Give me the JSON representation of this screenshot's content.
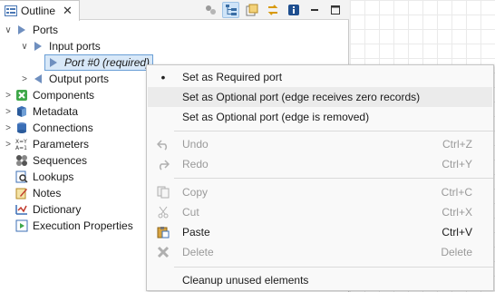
{
  "tab": {
    "title": "Outline",
    "close": "✕"
  },
  "toolbar": {
    "icons": [
      "tools-icon",
      "tree-layout-icon",
      "properties-icon",
      "sync-icon",
      "info-icon",
      "minimize-icon",
      "maximize-icon"
    ]
  },
  "tree": {
    "ports": "Ports",
    "input_ports": "Input ports",
    "port0": "Port #0 (required)",
    "output_ports": "Output ports",
    "components": "Components",
    "metadata": "Metadata",
    "connections": "Connections",
    "parameters": "Parameters",
    "sequences": "Sequences",
    "lookups": "Lookups",
    "notes": "Notes",
    "dictionary": "Dictionary",
    "execution_properties": "Execution Properties"
  },
  "menu": {
    "set_required": "Set as Required port",
    "set_optional_zero": "Set as Optional port (edge receives zero records)",
    "set_optional_removed": "Set as Optional port (edge is removed)",
    "undo": "Undo",
    "undo_sc": "Ctrl+Z",
    "redo": "Redo",
    "redo_sc": "Ctrl+Y",
    "copy": "Copy",
    "copy_sc": "Ctrl+C",
    "cut": "Cut",
    "cut_sc": "Ctrl+X",
    "paste": "Paste",
    "paste_sc": "Ctrl+V",
    "delete": "Delete",
    "delete_sc": "Delete",
    "cleanup": "Cleanup unused elements",
    "bullet": "•"
  },
  "colors": {
    "accent": "#2f6fb3",
    "selection": "#d8e8f8",
    "hover": "#ebebeb",
    "disabled_text": "#9a9a9a"
  }
}
